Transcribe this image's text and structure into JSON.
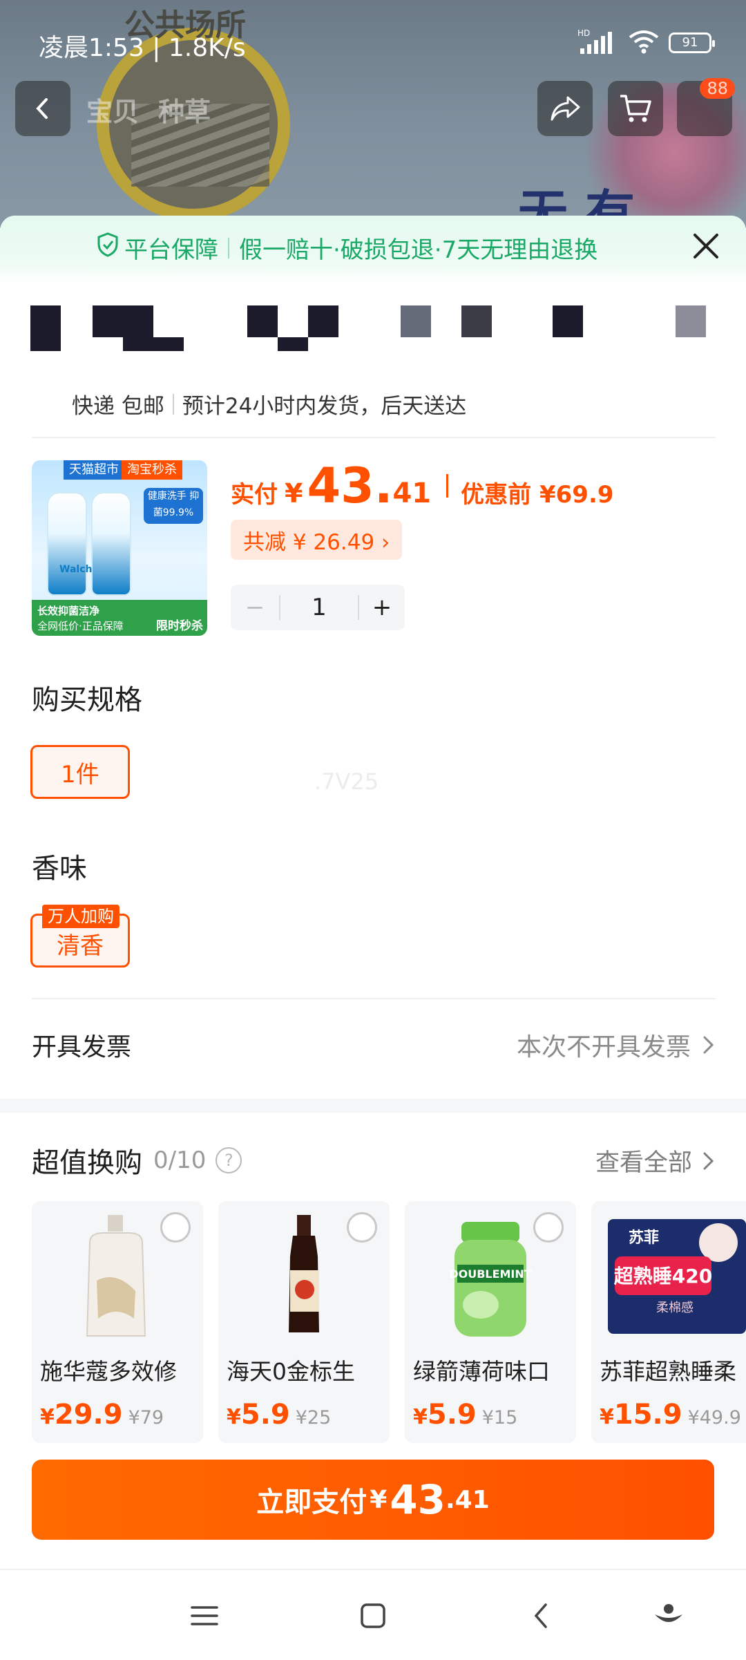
{
  "status_bar": {
    "time_speed": "凌晨1:53 | 1.8K/s",
    "battery": "91",
    "network": "HD"
  },
  "background_page": {
    "tabs": [
      "宝贝",
      "种草"
    ],
    "cart_badge": "88",
    "scene_text": "公共场所",
    "overlay_text": "无 有"
  },
  "sheet": {
    "guarantee": {
      "title": "平台保障",
      "terms": "假一赔十·破损包退·7天无理由退换"
    },
    "shipping": {
      "method": "快递 包邮",
      "estimate": "预计24小时内发货，后天送达"
    },
    "product": {
      "img_tags": [
        "天猫超市",
        "淘宝秒杀"
      ],
      "img_claim": "健康洗手 抑菌99.9%",
      "img_banner_top": "长效抑菌洁净",
      "img_banner_bottom": "全网低价·正品保障",
      "img_flash": "限时秒杀",
      "brand": "Walch"
    },
    "price": {
      "label": "实付",
      "yen": "¥",
      "integer": "43.",
      "decimal": "41",
      "before_label": "优惠前 ¥69.9",
      "discount": "共减 ¥ 26.49 ›"
    },
    "stepper": {
      "minus": "−",
      "qty": "1",
      "plus": "+"
    },
    "spec": {
      "title": "购买规格",
      "selected": "1件"
    },
    "scent": {
      "title": "香味",
      "selected": "清香",
      "tag": "万人加购"
    },
    "watermark": ".7V25",
    "invoice": {
      "label": "开具发票",
      "value": "本次不开具发票"
    },
    "swap": {
      "title": "超值换购",
      "count": "0/10",
      "help": "?",
      "view_all": "查看全部",
      "items": [
        {
          "name": "施华蔻多效修",
          "price": "29.9",
          "old": "¥79"
        },
        {
          "name": "海天0金标生",
          "price": "5.9",
          "old": "¥25"
        },
        {
          "name": "绿箭薄荷味口",
          "price": "5.9",
          "old": "¥15"
        },
        {
          "name": "苏菲超熟睡柔",
          "price": "15.9",
          "old": "¥49.9"
        }
      ],
      "img_texts": {
        "gum": "DOUBLEMINT",
        "pad": "超熟睡420",
        "pad_brand": "苏菲",
        "pad_sub": "柔棉感"
      }
    },
    "pay": {
      "label": "立即支付",
      "yen": "¥",
      "integer": "43",
      "decimal": ".41"
    }
  },
  "colors": {
    "accent": "#ff5000",
    "guarantee_green": "#1aa866",
    "discount_bg": "#ffe9df"
  }
}
